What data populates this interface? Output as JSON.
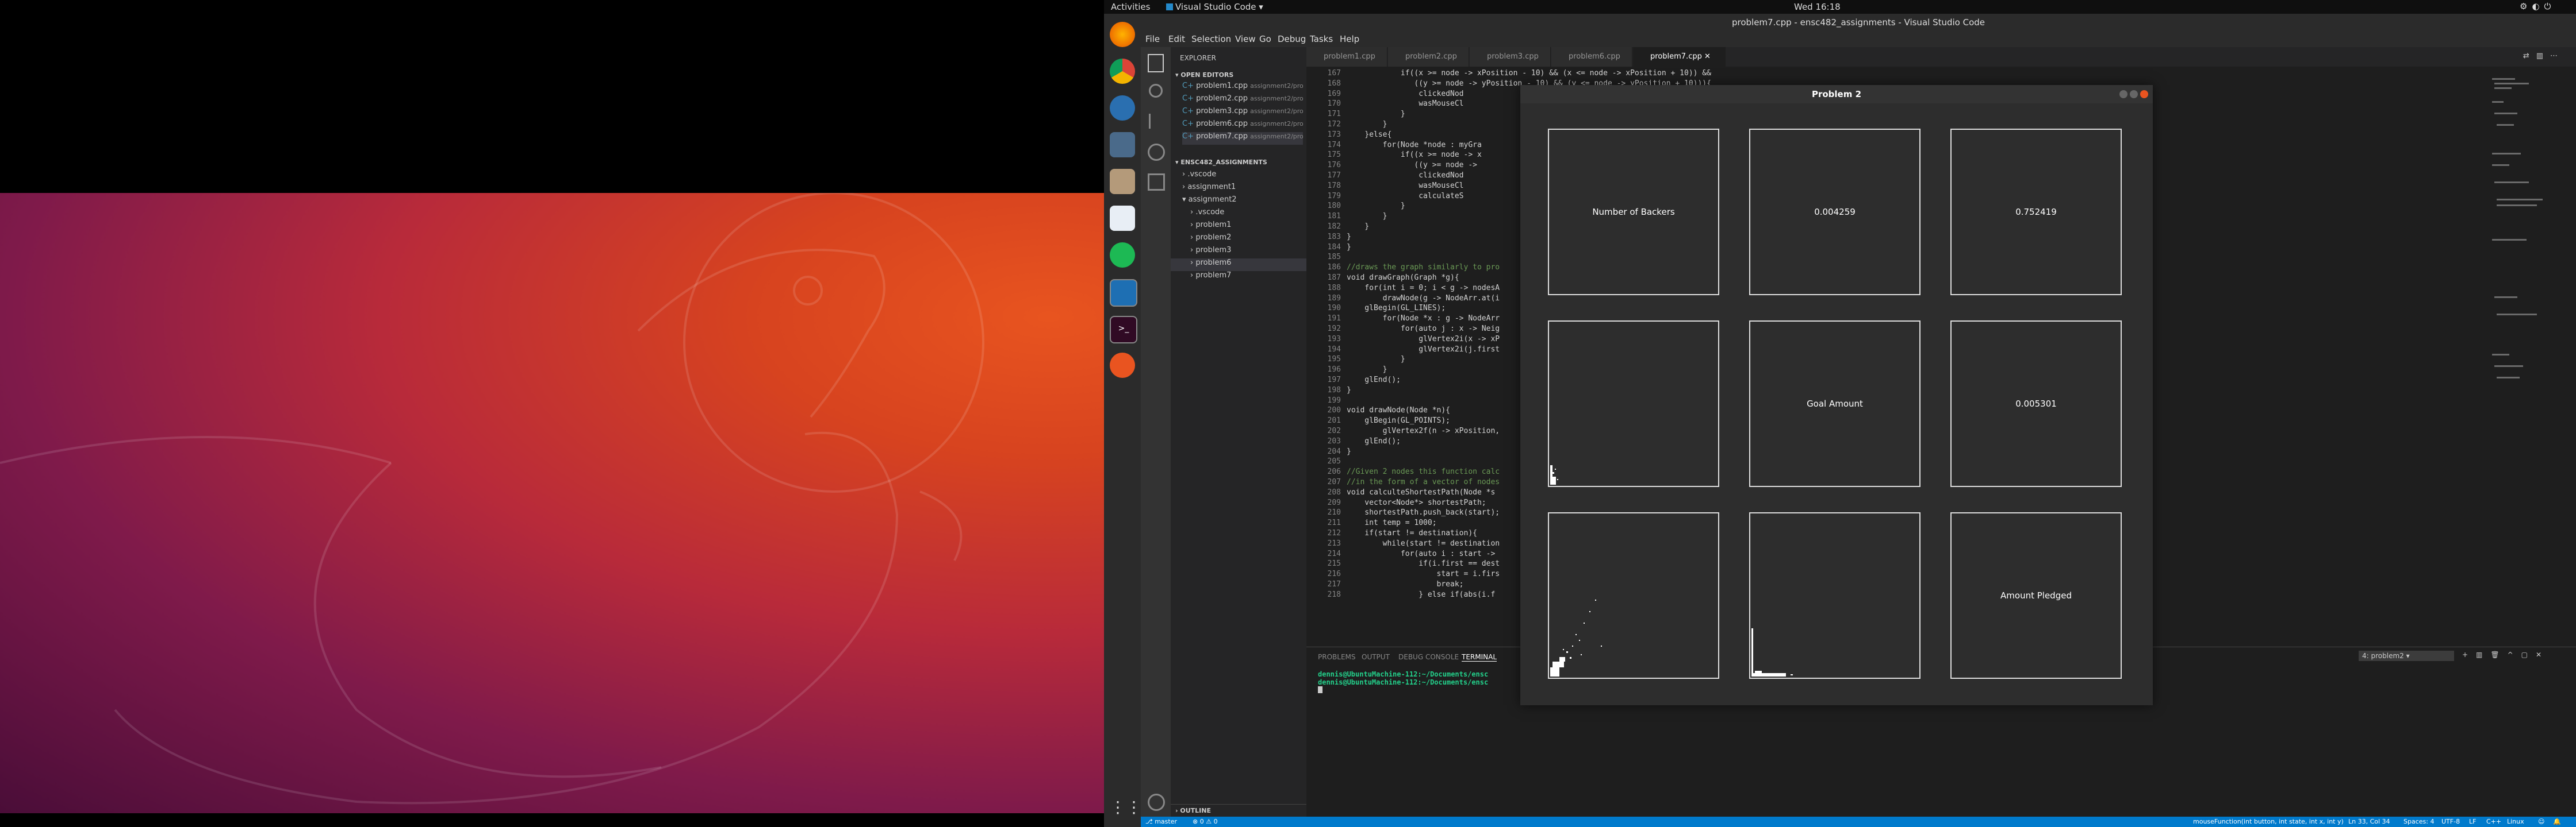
{
  "topbar": {
    "activities": "Activities",
    "app": "Visual Studio Code",
    "clock": "Wed 16:18"
  },
  "vscode": {
    "title": "problem7.cpp - ensc482_assignments - Visual Studio Code",
    "menu": [
      "File",
      "Edit",
      "Selection",
      "View",
      "Go",
      "Debug",
      "Tasks",
      "Help"
    ],
    "tabs": [
      "problem1.cpp",
      "problem2.cpp",
      "problem3.cpp",
      "problem6.cpp",
      "problem7.cpp"
    ],
    "explorer": {
      "header": "EXPLORER",
      "open_editors": "OPEN EDITORS",
      "open_files": [
        {
          "name": "problem1.cpp",
          "path": "assignment2/pro..."
        },
        {
          "name": "problem2.cpp",
          "path": "assignment2/pro..."
        },
        {
          "name": "problem3.cpp",
          "path": "assignment2/pro..."
        },
        {
          "name": "problem6.cpp",
          "path": "assignment2/pro..."
        },
        {
          "name": "problem7.cpp",
          "path": "assignment2/pro..."
        }
      ],
      "project": "ENSC482_ASSIGNMENTS",
      "tree": [
        ".vscode",
        "assignment1",
        "assignment2",
        ".vscode",
        "problem1",
        "problem2",
        "problem3",
        "problem6",
        "problem7"
      ],
      "outline": "OUTLINE"
    },
    "code_lines": [
      {
        "n": "167",
        "t": "            if((x >= node -> xPosition - 10) && (x <= node -> xPosition + 10)) &&"
      },
      {
        "n": "168",
        "t": "               ((y >= node -> yPosition - 10) && (y <= node -> yPosition + 10))){"
      },
      {
        "n": "169",
        "t": "                clickedNod"
      },
      {
        "n": "170",
        "t": "                wasMouseCl"
      },
      {
        "n": "171",
        "t": "            }"
      },
      {
        "n": "172",
        "t": "        }"
      },
      {
        "n": "173",
        "t": "    }else{"
      },
      {
        "n": "174",
        "t": "        for(Node *node : myGra"
      },
      {
        "n": "175",
        "t": "            if((x >= node -> x"
      },
      {
        "n": "176",
        "t": "               ((y >= node -> "
      },
      {
        "n": "177",
        "t": "                clickedNod"
      },
      {
        "n": "178",
        "t": "                wasMouseCl"
      },
      {
        "n": "179",
        "t": "                calculateS"
      },
      {
        "n": "180",
        "t": "            }"
      },
      {
        "n": "181",
        "t": "        }"
      },
      {
        "n": "182",
        "t": "    }"
      },
      {
        "n": "183",
        "t": "}"
      },
      {
        "n": "184",
        "t": "}"
      },
      {
        "n": "185",
        "t": ""
      },
      {
        "n": "186",
        "t": "//draws the graph similarly to pro"
      },
      {
        "n": "187",
        "t": "void drawGraph(Graph *g){"
      },
      {
        "n": "188",
        "t": "    for(int i = 0; i < g -> nodesA"
      },
      {
        "n": "189",
        "t": "        drawNode(g -> NodeArr.at(i"
      },
      {
        "n": "190",
        "t": "    glBegin(GL_LINES);"
      },
      {
        "n": "191",
        "t": "        for(Node *x : g -> NodeArr"
      },
      {
        "n": "192",
        "t": "            for(auto j : x -> Neig"
      },
      {
        "n": "193",
        "t": "                glVertex2i(x -> xP"
      },
      {
        "n": "194",
        "t": "                glVertex2i(j.first"
      },
      {
        "n": "195",
        "t": "            }"
      },
      {
        "n": "196",
        "t": "        }"
      },
      {
        "n": "197",
        "t": "    glEnd();"
      },
      {
        "n": "198",
        "t": "}"
      },
      {
        "n": "199",
        "t": ""
      },
      {
        "n": "200",
        "t": "void drawNode(Node *n){"
      },
      {
        "n": "201",
        "t": "    glBegin(GL_POINTS);"
      },
      {
        "n": "202",
        "t": "        glVertex2f(n -> xPosition,"
      },
      {
        "n": "203",
        "t": "    glEnd();"
      },
      {
        "n": "204",
        "t": "}"
      },
      {
        "n": "205",
        "t": ""
      },
      {
        "n": "206",
        "t": "//Given 2 nodes this function calc"
      },
      {
        "n": "207",
        "t": "//in the form of a vector of nodes"
      },
      {
        "n": "208",
        "t": "void calculteShortestPath(Node *s"
      },
      {
        "n": "209",
        "t": "    vector<Node*> shortestPath;"
      },
      {
        "n": "210",
        "t": "    shortestPath.push_back(start);"
      },
      {
        "n": "211",
        "t": "    int temp = 1000;"
      },
      {
        "n": "212",
        "t": "    if(start != destination){"
      },
      {
        "n": "213",
        "t": "        while(start != destination"
      },
      {
        "n": "214",
        "t": "            for(auto i : start -> "
      },
      {
        "n": "215",
        "t": "                if(i.first == dest"
      },
      {
        "n": "216",
        "t": "                    start = i.firs"
      },
      {
        "n": "217",
        "t": "                    break;"
      },
      {
        "n": "218",
        "t": "                } else if(abs(i.f"
      }
    ],
    "panel_tabs": [
      "PROBLEMS",
      "OUTPUT",
      "DEBUG CONSOLE",
      "TERMINAL"
    ],
    "terminal_select": "4: problem2",
    "terminal_lines": [
      "dennis@UbuntuMachine-112:~/Documents/ensc",
      "dennis@UbuntuMachine-112:~/Documents/ensc"
    ],
    "status": {
      "branch": "master",
      "problems": "0 ⚠ 0",
      "function": "mouseFunction(int button, int state, int x, int y)",
      "position": "Ln 33, Col 34",
      "spaces": "Spaces: 4",
      "encoding": "UTF-8",
      "eol": "LF",
      "lang": "C++",
      "os": "Linux"
    }
  },
  "problem_window": {
    "title": "Problem 2",
    "cells": [
      {
        "label": "Number of Backers"
      },
      {
        "label": "0.004259"
      },
      {
        "label": "0.752419"
      },
      {
        "label": ""
      },
      {
        "label": "Goal Amount"
      },
      {
        "label": "0.005301"
      },
      {
        "label": ""
      },
      {
        "label": ""
      },
      {
        "label": "Amount Pledged"
      }
    ]
  }
}
